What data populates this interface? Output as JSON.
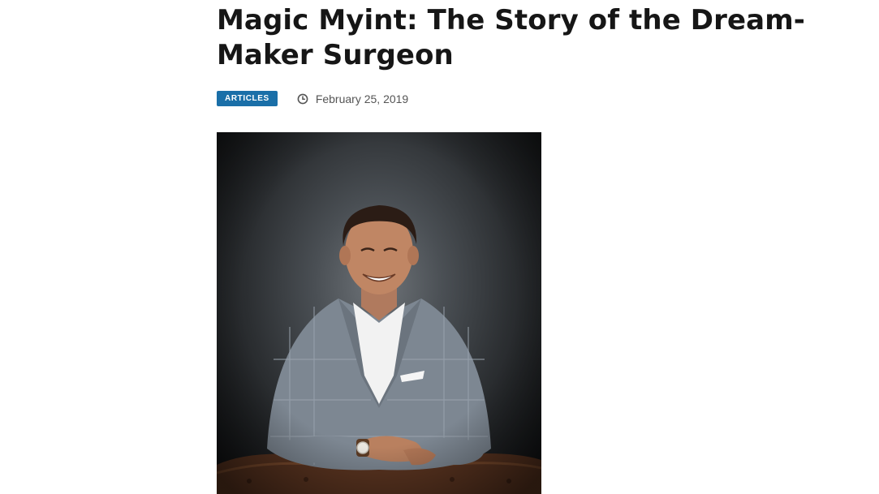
{
  "article": {
    "title": "Magic Myint: The Story of the Dream-Maker Surgeon",
    "category_badge": "ARTICLES",
    "date": "February 25, 2019",
    "icons": {
      "date_icon": "clock-icon"
    }
  },
  "colors": {
    "badge_background": "#1a6fa8",
    "title_text": "#161616",
    "date_text": "#555555"
  }
}
